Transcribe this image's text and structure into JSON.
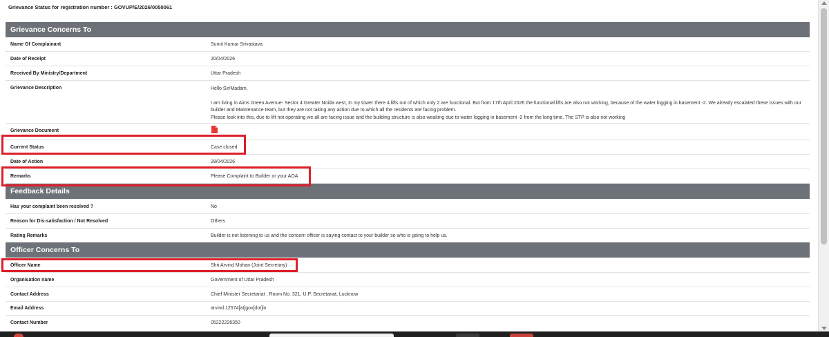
{
  "page_title": "Grievance Status for registration number : GOVUP/E/2026/0050061",
  "sections": {
    "concerns": {
      "title": "Grievance Concerns To",
      "rows": [
        {
          "label": "Name Of Complainant",
          "value": "Sumit Kumar Srivastava"
        },
        {
          "label": "Date of Receipt",
          "value": "20/04/2026"
        },
        {
          "label": "Received By Ministry/Department",
          "value": "Uttar Pradesh"
        }
      ],
      "description": {
        "label": "Grievance Description",
        "greeting": "Hello Sir/Madam,",
        "body": "I am living in Aims Green Avenue- Sector 4 Greater Noida west, In my tower there 4 lifts out of which only 2 are functional. But from 17th April 2026 the functional lifts are also not working, because of the water logging in basement -2. We already escalated these issues with our builder and Maintenance team, but they are not taking any action due to which all the residents are facing problem.",
        "closing": "Please look into this, due to lift not operating we all are facing issue and the building structure is also weaking due to water logging in basement -2 from the long time. The STP is also not working"
      },
      "document_label": "Grievance Document",
      "status_rows": [
        {
          "label": "Current Status",
          "value": "Case closed"
        },
        {
          "label": "Date of Action",
          "value": "28/04/2026"
        },
        {
          "label": "Remarks",
          "value": "Please Complaint to Builder or your AOA"
        }
      ]
    },
    "feedback": {
      "title": "Feedback Details",
      "rows": [
        {
          "label": "Has your complaint been resolved ?",
          "value": "No"
        },
        {
          "label": "Reason for Dis-satisfaction / Not Resolved",
          "value": "Others"
        },
        {
          "label": "Rating Remarks",
          "value": "Builder is not listening to us and the concern officer is saying contact to your builder so who is going to help us."
        }
      ]
    },
    "officer": {
      "title": "Officer Concerns To",
      "rows": [
        {
          "label": "Officer Name",
          "value": "Shri Arvind Mohan (Joint Secretary)"
        },
        {
          "label": "Organisation name",
          "value": "Government of Uttar Pradesh"
        },
        {
          "label": "Contact Address",
          "value": "Chief Minister Secretariat , Room No. 321, U.P. Secretariat, Lucknow"
        },
        {
          "label": "Email Address",
          "value": "arvind.12574[at]gov[dot]in"
        },
        {
          "label": "Contact Number",
          "value": "05222226350"
        }
      ]
    }
  },
  "icons": {
    "document": "pdf-file-icon"
  },
  "colors": {
    "section_header": "#6d7278",
    "highlight": "#dd1f2a",
    "pdf_icon": "#e53935"
  }
}
